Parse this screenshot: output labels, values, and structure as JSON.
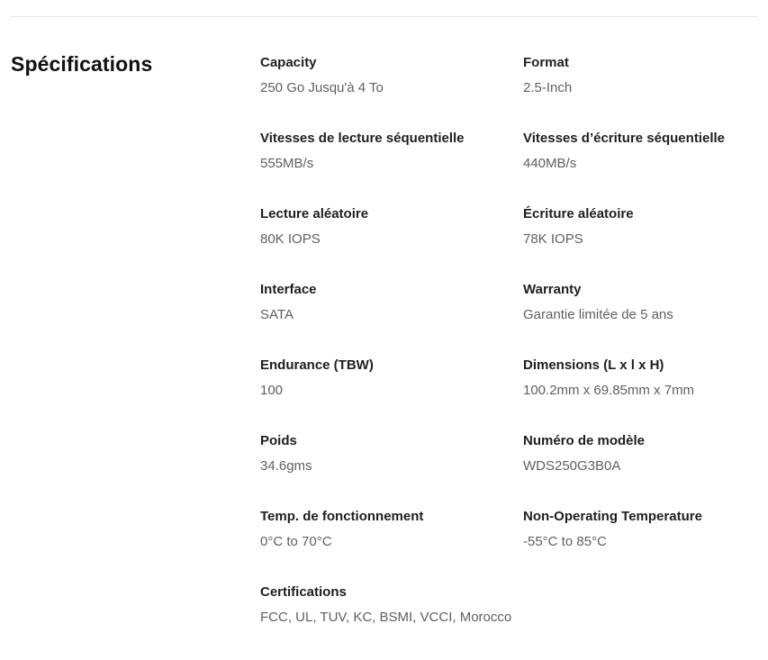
{
  "section": {
    "title": "Spécifications"
  },
  "specs": [
    {
      "label": "Capacity",
      "value": "250 Go Jusqu'à 4 To"
    },
    {
      "label": "Format",
      "value": "2.5-Inch"
    },
    {
      "label": "Vitesses de lecture séquentielle",
      "value": "555MB/s"
    },
    {
      "label": "Vitesses d’écriture séquentielle",
      "value": "440MB/s"
    },
    {
      "label": "Lecture aléatoire",
      "value": "80K IOPS"
    },
    {
      "label": "Écriture aléatoire",
      "value": "78K IOPS"
    },
    {
      "label": "Interface",
      "value": "SATA"
    },
    {
      "label": "Warranty",
      "value": "Garantie limitée de 5 ans"
    },
    {
      "label": "Endurance (TBW)",
      "value": "100"
    },
    {
      "label": "Dimensions (L x l x H)",
      "value": "100.2mm x 69.85mm x 7mm"
    },
    {
      "label": "Poids",
      "value": "34.6gms"
    },
    {
      "label": "Numéro de modèle",
      "value": "WDS250G3B0A"
    },
    {
      "label": "Temp. de fonctionnement",
      "value": "0°C to 70°C"
    },
    {
      "label": "Non-Operating Temperature",
      "value": "-55°C to 85°C"
    },
    {
      "label": "Certifications",
      "value": "FCC, UL, TUV, KC, BSMI, VCCI, Morocco"
    }
  ]
}
